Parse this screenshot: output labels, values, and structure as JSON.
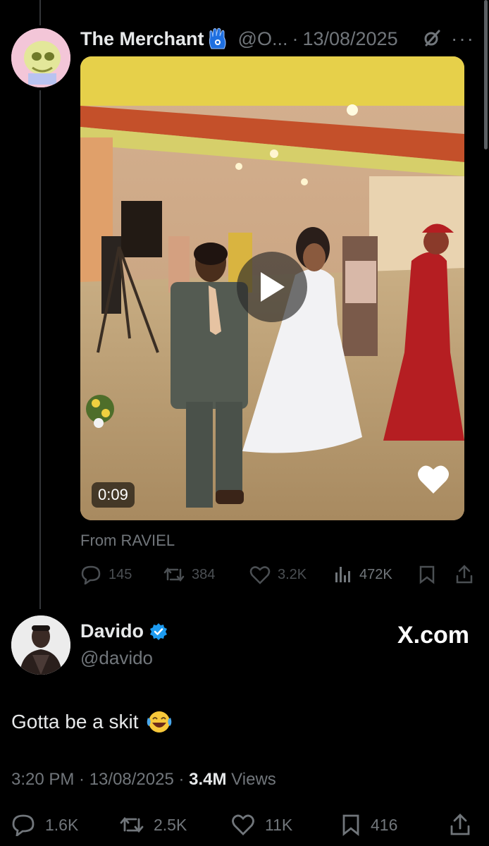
{
  "quoted_post": {
    "author_name": "The Merchant",
    "handle": "@O...",
    "separator": "·",
    "date": "13/08/2025",
    "video_duration": "0:09",
    "source_attribution": "From RAVIEL",
    "stats": {
      "replies": "145",
      "reposts": "384",
      "likes": "3.2K",
      "views": "472K"
    }
  },
  "post": {
    "author_name": "Davido",
    "handle": "@davido",
    "watermark": "X.com",
    "text": "Gotta be a skit",
    "time": "3:20 PM · 13/08/2025 · ",
    "views_count": "3.4M",
    "views_label": " Views",
    "stats": {
      "replies": "1.6K",
      "reposts": "2.5K",
      "likes": "11K",
      "bookmarks": "416"
    }
  },
  "colors": {
    "background": "#000000",
    "text_primary": "#e7e9ea",
    "text_secondary": "#71767b",
    "verified_badge": "#1d9bf0",
    "hamsa_emoji": "#1e6fe0"
  }
}
